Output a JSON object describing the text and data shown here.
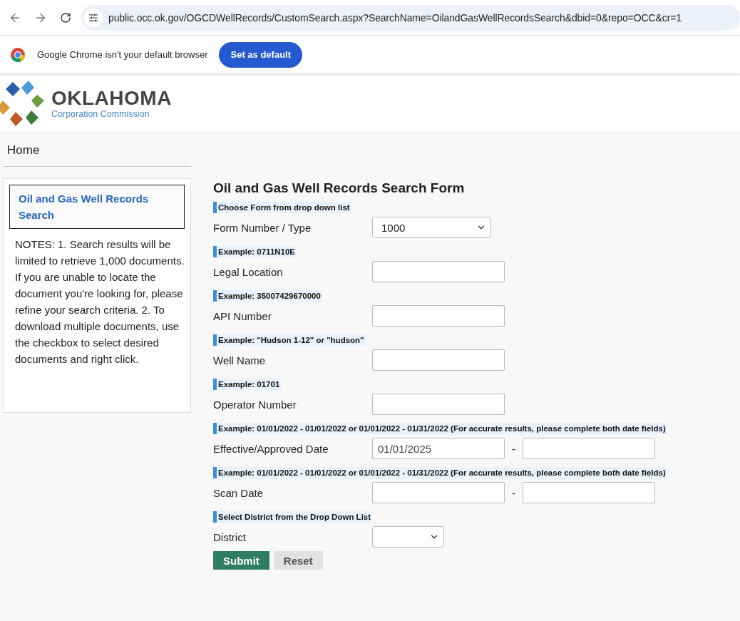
{
  "browser": {
    "url": "public.occ.ok.gov/OGCDWellRecords/CustomSearch.aspx?SearchName=OilandGasWellRecordsSearch&dbid=0&repo=OCC&cr=1"
  },
  "infobar": {
    "message": "Google Chrome isn't your default browser",
    "button": "Set as default"
  },
  "header": {
    "logo_title": "OKLAHOMA",
    "logo_subtitle": "Corporation Commission"
  },
  "nav": {
    "home": "Home"
  },
  "sidebar": {
    "link": "Oil and Gas Well Records Search",
    "notes": "NOTES: 1. Search results will be limited to retrieve 1,000 documents. If you are unable to locate the document you're looking for, please refine your search criteria. 2. To download multiple documents, use the checkbox to select desired documents and right click."
  },
  "form": {
    "title": "Oil and Gas Well Records Search Form",
    "fields": [
      {
        "kind": "select",
        "hint": "Choose Form from drop down list",
        "label": "Form Number / Type",
        "value": "1000"
      },
      {
        "kind": "text",
        "hint": "Example: 0711N10E",
        "label": "Legal Location"
      },
      {
        "kind": "text",
        "hint": "Example: 35007429670000",
        "label": "API Number"
      },
      {
        "kind": "text",
        "hint": "Example: \"Hudson 1-12\" or \"hudson\"",
        "label": "Well Name"
      },
      {
        "kind": "text",
        "hint": "Example: 01701",
        "label": "Operator Number"
      },
      {
        "kind": "range",
        "hint": "Example: 01/01/2022 - 01/01/2022 or 01/01/2022 - 01/31/2022 (For accurate results, please complete both date fields)",
        "label": "Effective/Approved Date",
        "value": "01/01/2025",
        "separator": "-"
      },
      {
        "kind": "range",
        "hint": "Example: 01/01/2022 - 01/01/2022 or 01/01/2022 - 01/31/2022 (For accurate results, please complete both date fields)",
        "label": "Scan Date",
        "separator": "-"
      },
      {
        "kind": "smallselect",
        "hint": "Select District from the Drop Down List",
        "label": "District"
      }
    ],
    "buttons": [
      {
        "kind": "primary",
        "label": "Submit"
      },
      {
        "kind": "secondary",
        "label": "Reset"
      }
    ]
  }
}
